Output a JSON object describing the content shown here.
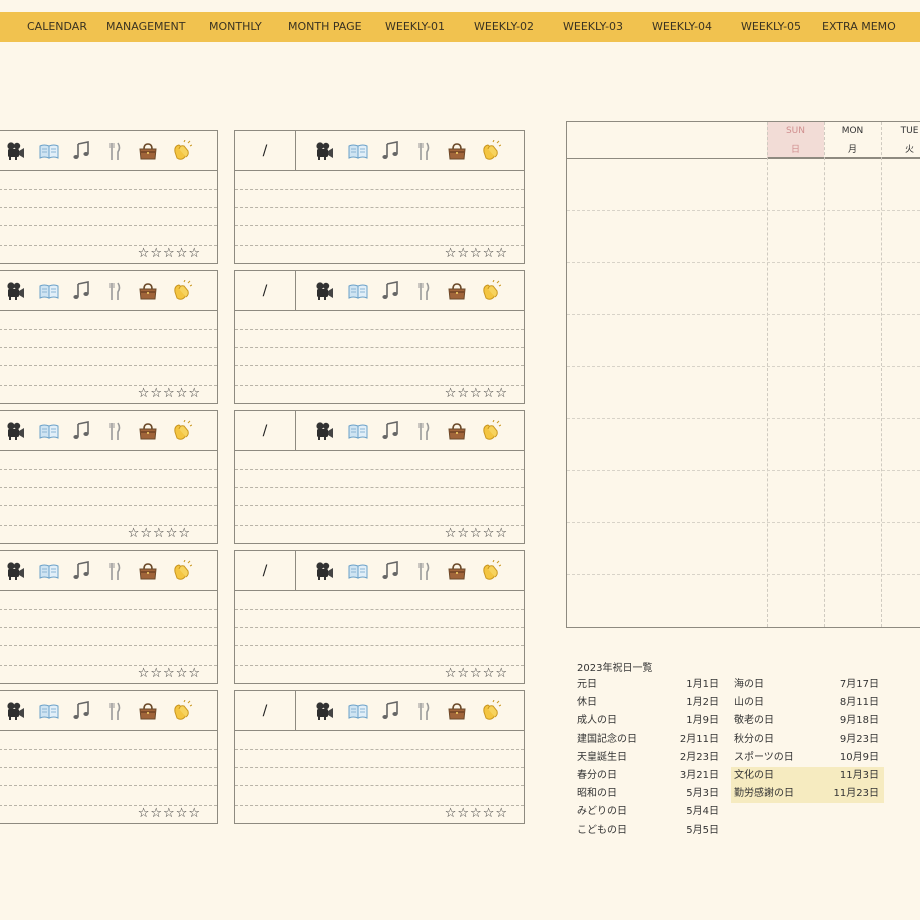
{
  "nav": {
    "tabs": [
      "CALENDAR",
      "MANAGEMENT",
      "MONTHLY",
      "MONTH PAGE",
      "WEEKLY-01",
      "WEEKLY-02",
      "WEEKLY-03",
      "WEEKLY-04",
      "WEEKLY-05",
      "EXTRA MEMO"
    ]
  },
  "log": {
    "date_separator": "/",
    "icons": [
      "movie-camera-icon",
      "open-book-icon",
      "music-notes-icon",
      "fork-and-knife-icon",
      "handbag-icon",
      "clapping-hands-icon"
    ],
    "stars": [
      "☆",
      "☆",
      "☆",
      "☆",
      "☆"
    ],
    "colors": {
      "border": "#8e8a80",
      "background": "#fdf7ea",
      "accent": "#f1c24f"
    }
  },
  "schedule": {
    "days": [
      {
        "en": "SUN",
        "jp": "日",
        "highlight": true
      },
      {
        "en": "MON",
        "jp": "月",
        "highlight": false
      },
      {
        "en": "TUE",
        "jp": "火",
        "highlight": false
      }
    ],
    "sun_color": "#d08f8f",
    "sun_bg": "#f2dcd6"
  },
  "holidays": {
    "title": "2023年祝日一覧",
    "left": [
      {
        "name": "元日",
        "date": "1月1日"
      },
      {
        "name": "休日",
        "date": "1月2日"
      },
      {
        "name": "成人の日",
        "date": "1月9日"
      },
      {
        "name": "建国記念の日",
        "date": "2月11日"
      },
      {
        "name": "天皇誕生日",
        "date": "2月23日"
      },
      {
        "name": "春分の日",
        "date": "3月21日"
      },
      {
        "name": "昭和の日",
        "date": "5月3日"
      },
      {
        "name": "みどりの日",
        "date": "5月4日"
      },
      {
        "name": "こどもの日",
        "date": "5月5日"
      }
    ],
    "right": [
      {
        "name": "海の日",
        "date": "7月17日",
        "highlight": false
      },
      {
        "name": "山の日",
        "date": "8月11日",
        "highlight": false
      },
      {
        "name": "敬老の日",
        "date": "9月18日",
        "highlight": false
      },
      {
        "name": "秋分の日",
        "date": "9月23日",
        "highlight": false
      },
      {
        "name": "スポーツの日",
        "date": "10月9日",
        "highlight": false
      },
      {
        "name": "文化の日",
        "date": "11月3日",
        "highlight": true
      },
      {
        "name": "勤労感謝の日",
        "date": "11月23日",
        "highlight": true
      }
    ],
    "highlight_color": "#f6ebc0"
  }
}
